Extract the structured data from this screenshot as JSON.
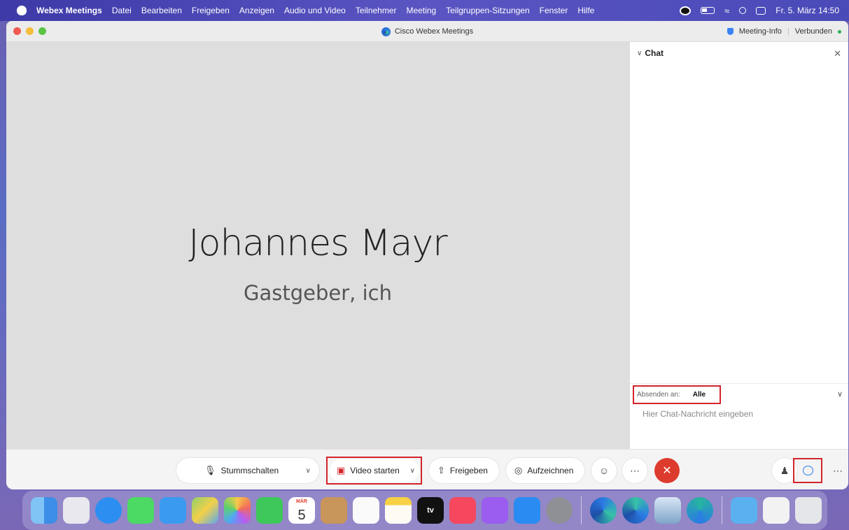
{
  "menubar": {
    "app_name": "Webex Meetings",
    "items": [
      "Datei",
      "Bearbeiten",
      "Freigeben",
      "Anzeigen",
      "Audio und Video",
      "Teilnehmer",
      "Meeting",
      "Teilgruppen-Sitzungen",
      "Fenster",
      "Hilfe"
    ],
    "datetime": "Fr. 5. März  14:50"
  },
  "window": {
    "title": "Cisco Webex Meetings",
    "meeting_info": "Meeting-Info",
    "connection_status": "Verbunden"
  },
  "stage": {
    "participant_name": "Johannes Mayr",
    "participant_role": "Gastgeber, ich"
  },
  "chat": {
    "title": "Chat",
    "send_to_label": "Absenden an:",
    "send_to_value": "Alle",
    "input_placeholder": "Hier Chat-Nachricht eingeben"
  },
  "controls": {
    "mute_label": "Stummschalten",
    "video_label": "Video starten",
    "share_label": "Freigeben",
    "record_label": "Aufzeichnen"
  },
  "dock": {
    "calendar_month": "MÄR",
    "calendar_day": "5",
    "tv_label": "tv",
    "apps": [
      "finder",
      "launchpad",
      "safari",
      "messages",
      "mail",
      "maps",
      "photos",
      "facetime",
      "calendar",
      "contacts",
      "reminders",
      "notes",
      "tv",
      "music",
      "podcasts",
      "app-store",
      "system-preferences",
      "webex-meetings",
      "webex",
      "preview",
      "webex-teams",
      "downloads",
      "document",
      "trash"
    ]
  },
  "colors": {
    "highlight_red": "#d3252a",
    "end_call": "#dd3b2d",
    "chat_accent": "#2c7be5"
  }
}
